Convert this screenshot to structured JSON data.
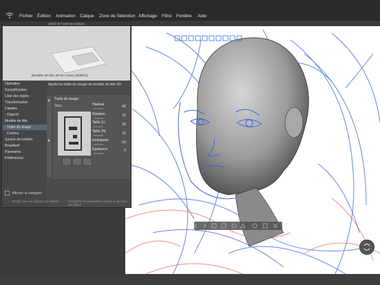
{
  "menu": {
    "items": [
      "Fichier",
      "Édition",
      "Animation",
      "Calque",
      "Zone de Sélection",
      "Affichage",
      "Filtre",
      "Fenêtre",
      "Aide"
    ]
  },
  "panel": {
    "title": "Détail de l'outil secondaire",
    "preview_label": "[Modèle de tête 3D En cours d'édition]",
    "categories": [
      {
        "label": "Opération",
        "sub": false,
        "selected": false
      },
      {
        "label": "Sound/Gestes",
        "sub": false,
        "selected": false
      },
      {
        "label": "Liste des objets",
        "sub": false,
        "selected": false
      },
      {
        "label": "Transformation",
        "sub": false,
        "selected": false
      },
      {
        "label": "Caméra",
        "sub": false,
        "selected": false
      },
      {
        "label": "Objectif",
        "sub": true,
        "selected": false
      },
      {
        "label": "Modèle de tête",
        "sub": false,
        "selected": false
      },
      {
        "label": "Traits du visage",
        "sub": true,
        "selected": true
      },
      {
        "label": "Contour",
        "sub": true,
        "selected": false
      },
      {
        "label": "Source de lumière",
        "sub": false,
        "selected": false
      },
      {
        "label": "Brouillard",
        "sub": false,
        "selected": false
      },
      {
        "label": "Panorama",
        "sub": false,
        "selected": false
      },
      {
        "label": "Préférences",
        "sub": false,
        "selected": false
      }
    ],
    "show_category_label": "Afficher la catégorie",
    "reset_label": "Rétablir tous les réglages par défaut",
    "save_label": "Enregistrer les paramètres actuels en tant que par défaut",
    "description": "Ajuste les traits du visage du modèle de tête 3D.",
    "group_title": "Traits du visage",
    "part_label": "Yeux",
    "params": [
      {
        "name": "Hauteur",
        "value": "-42"
      },
      {
        "name": "Rotation",
        "value": "10"
      },
      {
        "name": "Taille (L)",
        "value": "15"
      },
      {
        "name": "Taille (H)",
        "value": "15"
      },
      {
        "name": "Inclinaison",
        "value": "-10"
      },
      {
        "name": "Épaisseur",
        "value": "0"
      }
    ]
  },
  "colors": {
    "menubar_bg": "#2a2a2a",
    "canvas_bg": "#ffffff",
    "sketch_blue": "#3a66d8",
    "sketch_red": "#e05a4a",
    "panel_bg": "#4b4b4b",
    "selected_bg": "#5e6670"
  }
}
